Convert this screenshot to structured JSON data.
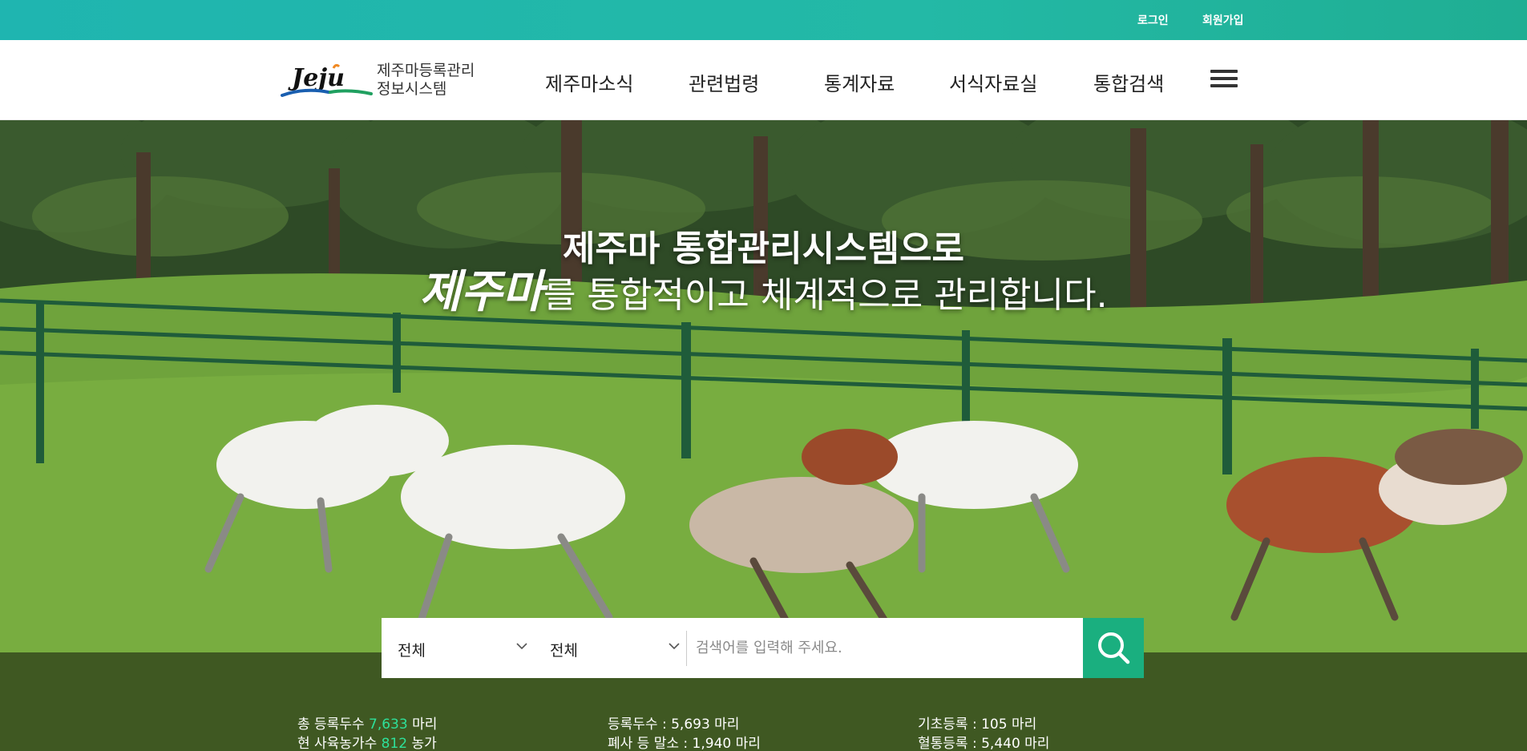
{
  "topbar": {
    "login": "로그인",
    "join": "회원가입"
  },
  "logo": {
    "mark": "Jeju",
    "line1": "제주마등록관리",
    "line2": "정보시스템"
  },
  "nav": [
    "제주마소식",
    "관련법령",
    "통계자료",
    "서식자료실",
    "통합검색"
  ],
  "hero": {
    "line1": "제주마 통합관리시스템으로",
    "brush": "제주마",
    "line2_rest": "를 통합적이고 체계적으로 관리합니다."
  },
  "search": {
    "select1": "전체",
    "select2": "전체",
    "placeholder": "검색어를 입력해 주세요."
  },
  "stats": {
    "total_label": "총 등록두수",
    "total_value": "7,633",
    "total_unit": "마리",
    "farms_label": "현 사육농가수",
    "farms_value": "812",
    "farms_unit": "농가",
    "registered": "등록두수 : 5,693 마리",
    "cancelled": "폐사 등 말소 : 1,940 마리",
    "basic": "기초등록 : 105 마리",
    "pedigree": "혈통등록 : 5,440 마리"
  },
  "colors": {
    "topbar": "#1fb5b0",
    "accent": "#1aaf7f",
    "highlight": "#2ee09a"
  }
}
